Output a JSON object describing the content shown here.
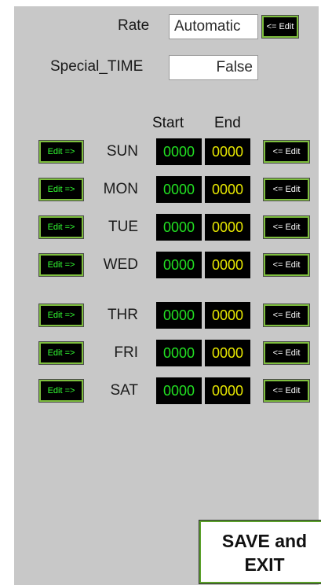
{
  "rate": {
    "label": "Rate",
    "value": "Automatic",
    "edit_label": "<= Edit"
  },
  "special_time": {
    "label": "Special_TIME",
    "value": "False"
  },
  "headers": {
    "start": "Start",
    "end": "End"
  },
  "days": [
    {
      "name": "SUN",
      "start": "0000",
      "end": "0000",
      "edit_start": "Edit =>",
      "edit_end": "<= Edit"
    },
    {
      "name": "MON",
      "start": "0000",
      "end": "0000",
      "edit_start": "Edit =>",
      "edit_end": "<= Edit"
    },
    {
      "name": "TUE",
      "start": "0000",
      "end": "0000",
      "edit_start": "Edit =>",
      "edit_end": "<= Edit"
    },
    {
      "name": "WED",
      "start": "0000",
      "end": "0000",
      "edit_start": "Edit =>",
      "edit_end": "<= Edit"
    },
    {
      "name": "THR",
      "start": "0000",
      "end": "0000",
      "edit_start": "Edit =>",
      "edit_end": "<= Edit"
    },
    {
      "name": "FRI",
      "start": "0000",
      "end": "0000",
      "edit_start": "Edit =>",
      "edit_end": "<= Edit"
    },
    {
      "name": "SAT",
      "start": "0000",
      "end": "0000",
      "edit_start": "Edit =>",
      "edit_end": "<= Edit"
    }
  ],
  "save": {
    "line1": "SAVE and",
    "line2": "EXIT"
  },
  "colors": {
    "panel": "#c8c8c8",
    "start_text": "#22e022",
    "end_text": "#e8e800",
    "button_border": "#7fbf3f"
  }
}
